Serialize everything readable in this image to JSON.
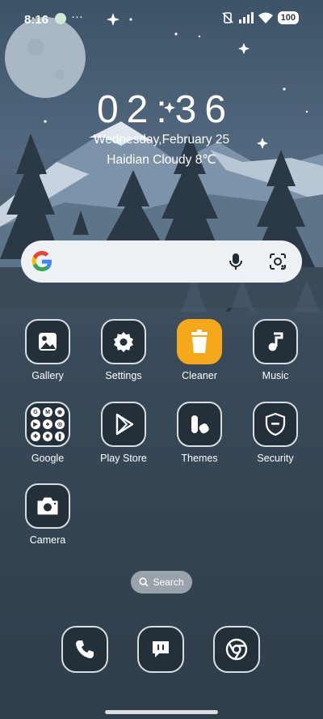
{
  "status_bar": {
    "time": "8:16",
    "overflow": "···",
    "battery": "100",
    "icons": [
      "notification-icon",
      "vibrate-off-icon",
      "signal-icon",
      "wifi-icon",
      "battery-icon"
    ]
  },
  "clock": {
    "time": "02:36",
    "date": "Wednesday,February 25",
    "weather": "Haidian Cloudy 8℃"
  },
  "search_bar": {
    "icons": [
      "google-logo-icon",
      "mic-icon",
      "lens-icon"
    ]
  },
  "apps": [
    {
      "label": "Gallery",
      "icon": "gallery-icon"
    },
    {
      "label": "Settings",
      "icon": "gear-icon"
    },
    {
      "label": "Cleaner",
      "icon": "trash-icon"
    },
    {
      "label": "Music",
      "icon": "music-note-icon"
    },
    {
      "label": "Google",
      "icon": "google-folder-icon"
    },
    {
      "label": "Play Store",
      "icon": "play-store-icon"
    },
    {
      "label": "Themes",
      "icon": "themes-icon"
    },
    {
      "label": "Security",
      "icon": "shield-icon"
    },
    {
      "label": "Camera",
      "icon": "camera-icon"
    }
  ],
  "google_folder_glyphs": [
    "G",
    "M",
    "◉",
    "▶",
    "♣",
    "◎",
    "✚",
    "✱",
    "❚"
  ],
  "search_pill": {
    "label": "Search"
  },
  "dock": [
    {
      "name": "phone",
      "icon": "phone-icon"
    },
    {
      "name": "messages",
      "icon": "message-icon"
    },
    {
      "name": "chrome",
      "icon": "chrome-icon"
    }
  ],
  "colors": {
    "accent": "#f5a81a",
    "icon_bg": "#243039",
    "icon_border": "#d8dde2"
  }
}
